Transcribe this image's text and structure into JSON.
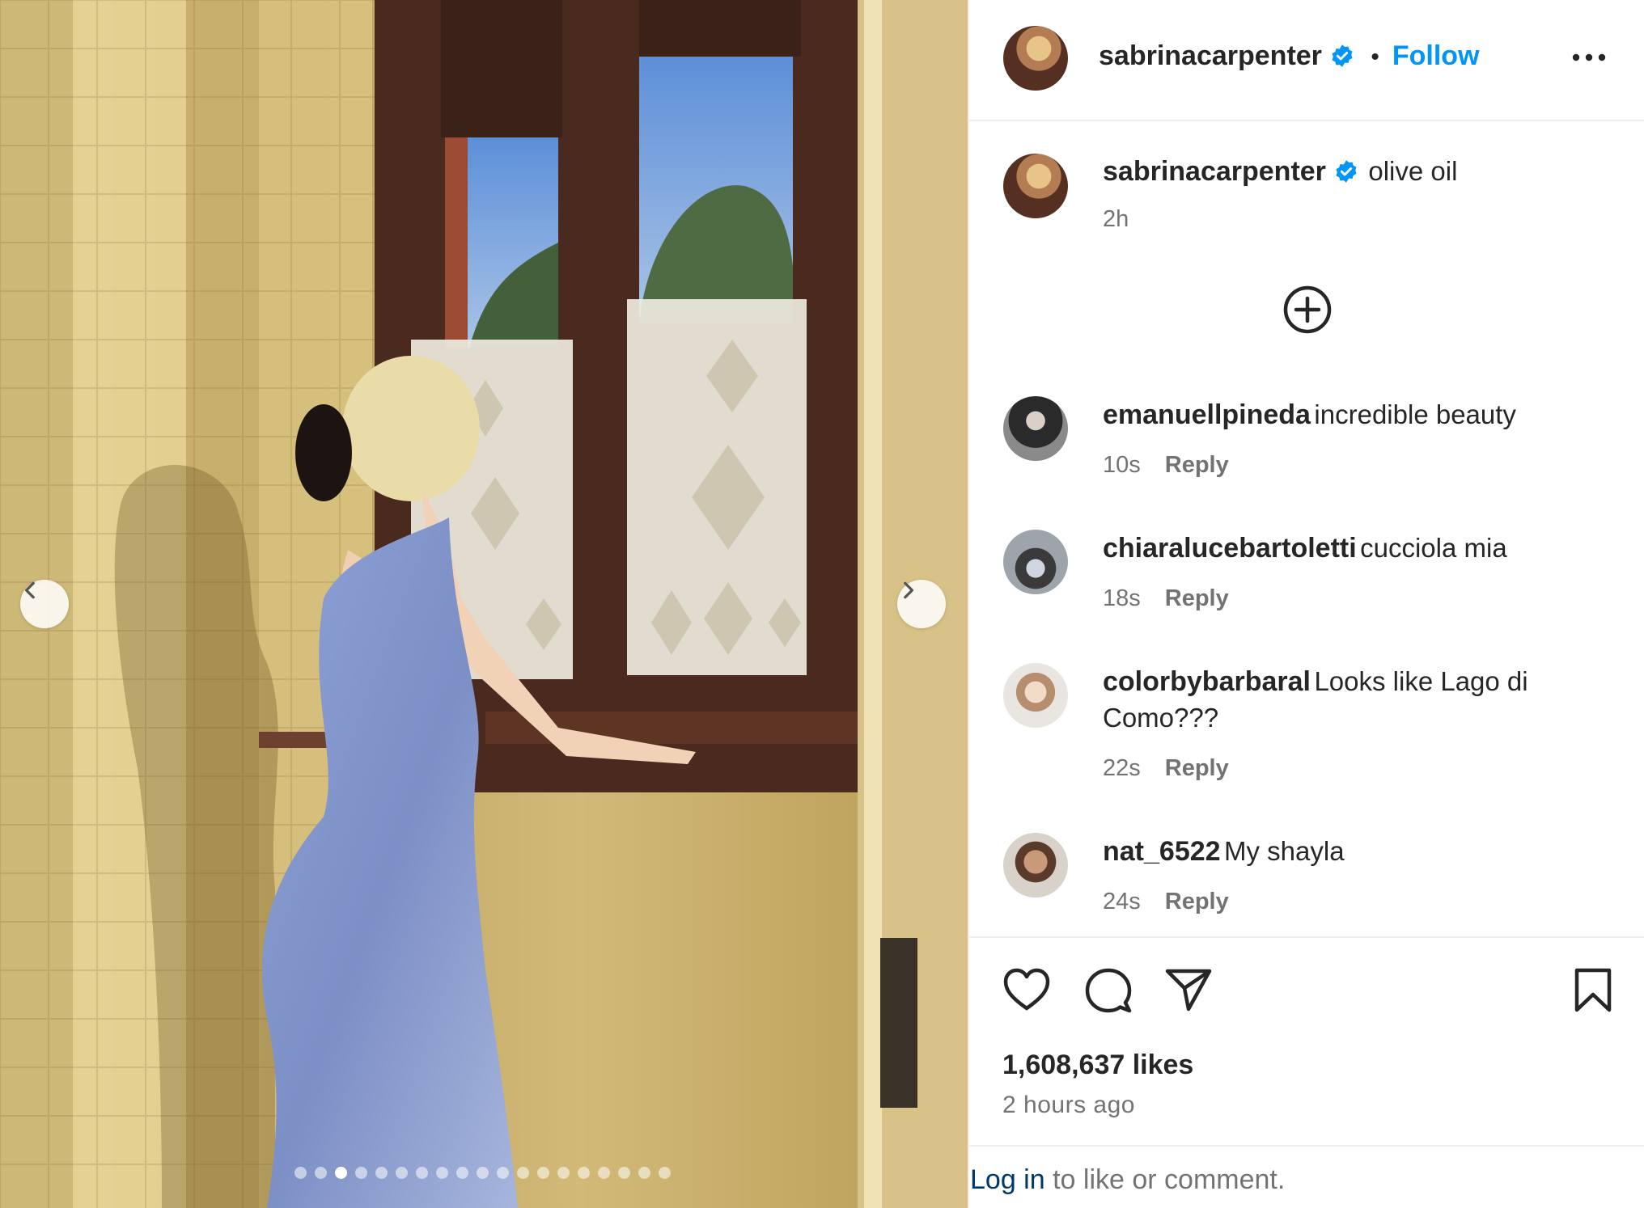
{
  "post": {
    "author": "sabrinacarpenter",
    "follow_label": "Follow",
    "separator": "•",
    "caption": "olive oil",
    "caption_time": "2h",
    "likes": "1,608,637 likes",
    "posted_ago": "2 hours ago",
    "carousel": {
      "total": 19,
      "active_index": 2
    }
  },
  "comments": [
    {
      "user": "emanuellpineda",
      "text": "incredible beauty",
      "time": "10s",
      "reply_label": "Reply"
    },
    {
      "user": "chiaralucebartoletti",
      "text": "cucciola mia",
      "time": "18s",
      "reply_label": "Reply"
    },
    {
      "user": "colorbybarbaral",
      "text": "Looks like Lago di",
      "text_line2": "Como???",
      "time": "22s",
      "reply_label": "Reply"
    },
    {
      "user": "nat_6522",
      "text": "My shayla",
      "time": "24s",
      "reply_label": "Reply"
    }
  ],
  "footer": {
    "login_link": "Log in",
    "login_rest": " to like or comment."
  },
  "icons": {
    "header_more": "more-horizontal-icon",
    "load_more": "plus-circle-icon",
    "like": "heart-icon",
    "comment": "comment-icon",
    "share": "send-icon",
    "save": "bookmark-icon",
    "verified": "verified-badge-icon",
    "prev": "chevron-left-icon",
    "next": "chevron-right-icon"
  },
  "colors": {
    "accent": "#0095f6",
    "verified": "#0095f6",
    "link": "#00376b",
    "muted": "#737373"
  }
}
